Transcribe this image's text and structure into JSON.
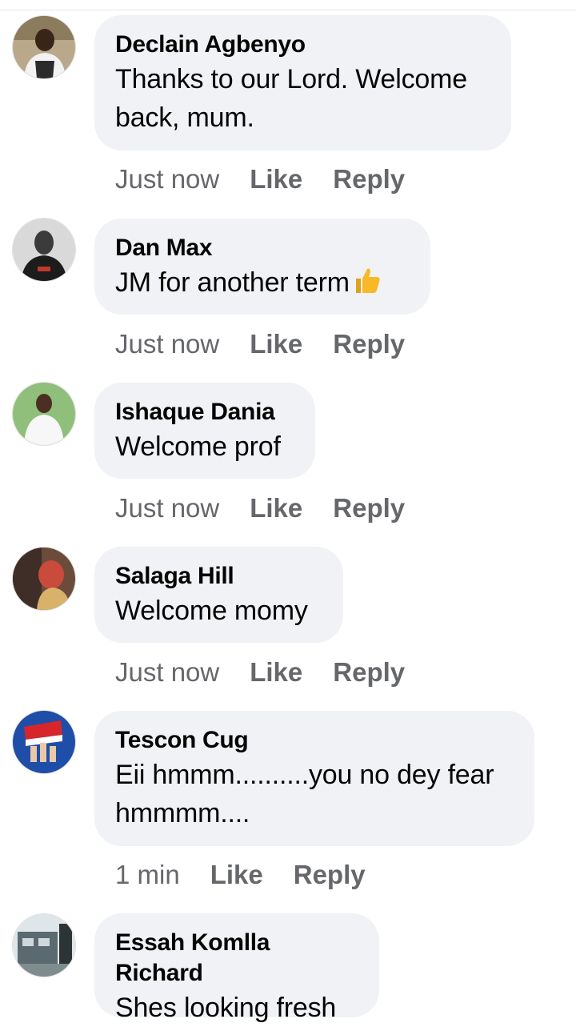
{
  "comments": [
    {
      "author": "Declain Agbenyo",
      "lines": [
        "Thanks to our Lord. Welcome",
        "back, mum."
      ],
      "time": "Just now",
      "like": "Like",
      "reply": "Reply",
      "avatar_icon": "profile-photo"
    },
    {
      "author": "Dan Max",
      "lines": [
        "JM for another term"
      ],
      "emoji": "thumbs-up-emoji",
      "time": "Just now",
      "like": "Like",
      "reply": "Reply",
      "avatar_icon": "profile-photo"
    },
    {
      "author": "Ishaque Dania",
      "lines": [
        "Welcome prof"
      ],
      "time": "Just now",
      "like": "Like",
      "reply": "Reply",
      "avatar_icon": "profile-photo"
    },
    {
      "author": "Salaga Hill",
      "lines": [
        "Welcome momy"
      ],
      "time": "Just now",
      "like": "Like",
      "reply": "Reply",
      "avatar_icon": "profile-photo"
    },
    {
      "author": "Tescon Cug",
      "lines": [
        "Eii hmmm..........you no dey fear",
        "hmmmm...."
      ],
      "time": "1 min",
      "like": "Like",
      "reply": "Reply",
      "avatar_icon": "profile-photo"
    },
    {
      "author": "Essah Komlla Richard",
      "lines": [
        "Shes looking fresh"
      ],
      "avatar_icon": "profile-photo"
    }
  ],
  "colors": {
    "bubble": "#f0f2f5",
    "text": "#050505",
    "meta": "#65676b",
    "thumb": "#f7b928"
  }
}
